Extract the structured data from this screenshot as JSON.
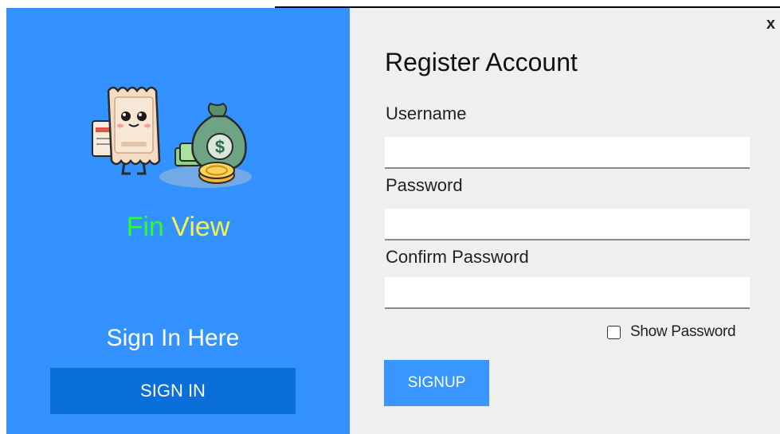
{
  "brand": {
    "part1": "Fin",
    "part2": "View",
    "colors": {
      "fin": "#2bff2b",
      "view": "#f7f34a"
    },
    "logo_icon": "tax-money-mascot-icon"
  },
  "left_panel": {
    "background": "#3392ff",
    "signin_caption": "Sign In Here",
    "signin_button": "SIGN IN"
  },
  "form": {
    "title": "Register Account",
    "username_label": "Username",
    "username_value": "",
    "password_label": "Password",
    "password_value": "",
    "confirm_label": "Confirm Password",
    "confirm_value": "",
    "show_password_label": "Show Password",
    "show_password_checked": false,
    "signup_button": "SIGNUP",
    "close_glyph": "x"
  }
}
